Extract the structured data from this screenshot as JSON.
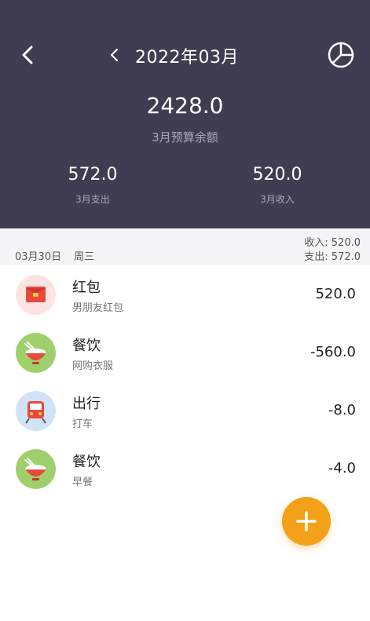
{
  "header": {
    "title": "2022年03月",
    "balance": "2428.0",
    "balance_label": "3月预算余额",
    "expense_value": "572.0",
    "expense_label": "3月支出",
    "income_value": "520.0",
    "income_label": "3月收入",
    "bg_color": "#403d52"
  },
  "day": {
    "date": "03月30日",
    "weekday": "周三",
    "income": "收入: 520.0",
    "expense": "支出: 572.0"
  },
  "records": [
    {
      "category": "红包",
      "note": "男朋友红包",
      "amount": "520.0",
      "icon": "red-envelope-icon"
    },
    {
      "category": "餐饮",
      "note": "网购衣服",
      "amount": "-560.0",
      "icon": "rice-bowl-icon"
    },
    {
      "category": "出行",
      "note": "打车",
      "amount": "-8.0",
      "icon": "train-icon"
    },
    {
      "category": "餐饮",
      "note": "早餐",
      "amount": "-4.0",
      "icon": "rice-bowl-icon"
    }
  ],
  "fab": {
    "icon": "plus-icon",
    "color": "#f4a11a"
  }
}
